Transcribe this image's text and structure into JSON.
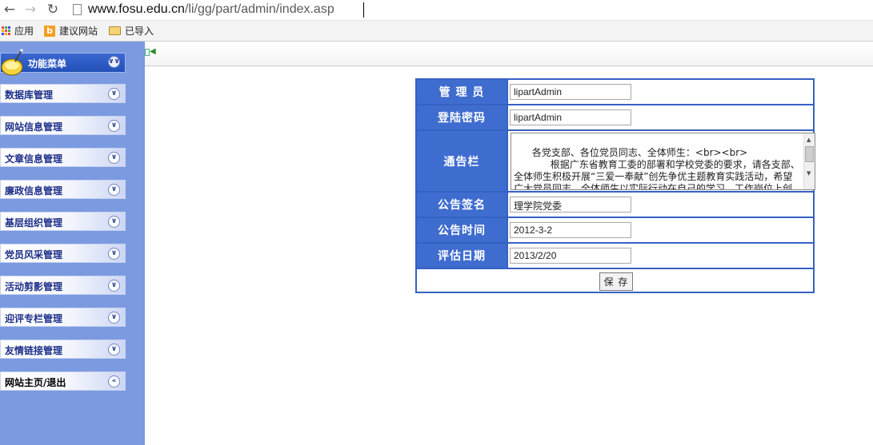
{
  "browser": {
    "url_host": "www.fosu.edu.cn",
    "url_path": "/li/gg/part/admin/index.asp",
    "bookmarks": [
      "应用",
      "建议网站",
      "已导入"
    ]
  },
  "sidebar": {
    "header": "功能菜单",
    "items": [
      "数据库管理",
      "网站信息管理",
      "文章信息管理",
      "廉政信息管理",
      "基层组织管理",
      "党员风采管理",
      "活动剪影管理",
      "迎评专栏管理",
      "友情链接管理",
      "网站主页/退出"
    ]
  },
  "form": {
    "admin_label": "管 理 员",
    "admin_value": "lipartAdmin",
    "password_label": "登陆密码",
    "password_value": "lipartAdmin",
    "notice_label": "通告栏",
    "notice_text": "各党支部、各位党员同志、全体师生：<br><br>\n            根据广东省教育工委的部署和学校党委的要求，请各支部、全体师生积极开展“三爱一奉献”创先争优主题教育实践活动，希望广大党员同志、全体师生以实际行动在自己的学习、工作岗位上创先争优，真正发挥党支部的战斗堡垒作用和共产党员的先锋模范带头作",
    "signature_label": "公告签名",
    "signature_value": "理学院党委",
    "time_label": "公告时间",
    "time_value": "2012-3-2",
    "eval_label": "评估日期",
    "eval_value": "2013/2/20",
    "save_label": "保 存"
  }
}
